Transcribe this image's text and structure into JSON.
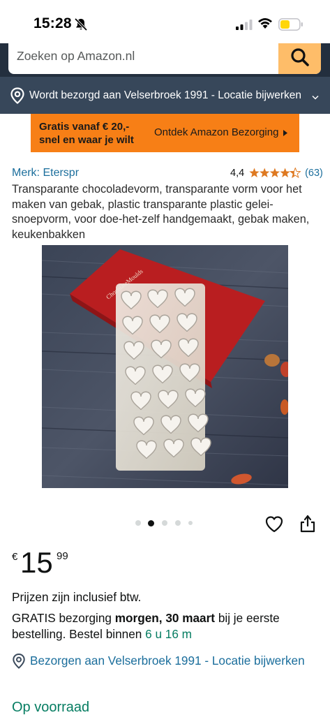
{
  "status_bar": {
    "time": "15:28",
    "icons": [
      "bell-slash-icon",
      "signal-icon",
      "wifi-icon",
      "battery-icon"
    ],
    "battery_color": "#ffd60a"
  },
  "search": {
    "placeholder": "Zoeken op Amazon.nl",
    "button_color": "#febd69",
    "icon": "search-icon"
  },
  "delivery": {
    "text": "Wordt bezorgd aan Velserbroek 1991 - Locatie bijwerken",
    "icon": "location-pin-icon"
  },
  "promo": {
    "line1": "Gratis vanaf € 20,-",
    "line2": "snel en waar je wilt",
    "cta": "Ontdek Amazon Bezorging",
    "color": "#f77f16"
  },
  "product": {
    "brand": "Merk: Eterspr",
    "rating": "4,4",
    "rating_count": "(63)",
    "stars": 4.4,
    "title": "Transparante chocoladevorm, transparante vorm voor het maken van gebak, plastic transparante plastic gelei-snoepvorm, voor doe-het-zelf handgemaakt, gebak maken, keukenbakken",
    "image": {
      "description_icon": "product-image",
      "box_text": "ChocolateMoulds"
    },
    "carousel": {
      "count": 5,
      "active": 1
    }
  },
  "price": {
    "currency": "€",
    "whole": "15",
    "fraction": "99"
  },
  "vat": "Prijzen zijn inclusief btw.",
  "shipping": {
    "prefix": "GRATIS bezorging ",
    "date": "morgen, 30 maart",
    "middle": " bij je eerste bestelling. Bestel binnen ",
    "countdown": "6 u 16 m"
  },
  "deliver_to": "Bezorgen aan Velserbroek 1991 - Locatie bijwerken",
  "stock": "Op voorraad",
  "colors": {
    "link": "#1b6e9c",
    "header": "#232f3e",
    "subheader": "#37475a",
    "success": "#067d62",
    "star": "#de7921"
  }
}
